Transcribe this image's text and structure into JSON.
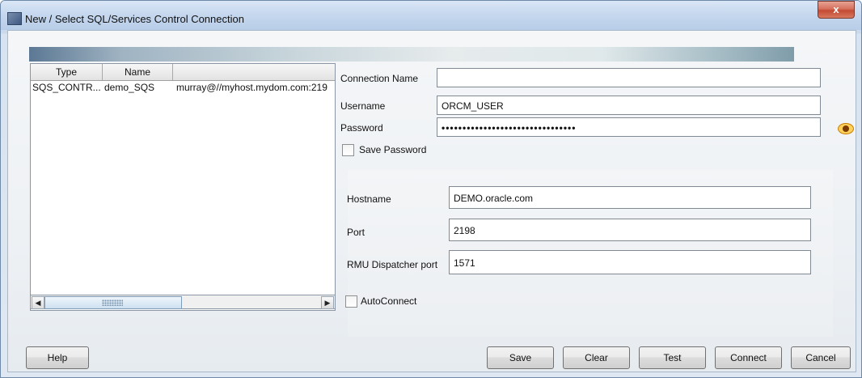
{
  "window": {
    "title": "New / Select SQL/Services Control Connection",
    "close_glyph": "x"
  },
  "list": {
    "columns": [
      "Type",
      "Name",
      ""
    ],
    "rows": [
      {
        "type": "SQS_CONTR...",
        "name": "demo_SQS",
        "connection": "murray@//myhost.mydom.com:219"
      }
    ]
  },
  "form": {
    "connection_name": {
      "label": "Connection Name",
      "value": ""
    },
    "username": {
      "label": "Username",
      "value": "ORCM_USER"
    },
    "password": {
      "label": "Password",
      "value": "••••••••••••••••••••••••••••••••"
    },
    "save_password": {
      "label": "Save Password",
      "checked": false
    },
    "hostname": {
      "label": "Hostname",
      "value": "DEMO.oracle.com"
    },
    "port": {
      "label": "Port",
      "value": "2198"
    },
    "rmu_port": {
      "label": "RMU Dispatcher port",
      "value": "1571"
    },
    "autoconnect": {
      "label": "AutoConnect",
      "checked": false
    }
  },
  "buttons": {
    "help": "Help",
    "save": "Save",
    "clear": "Clear",
    "test": "Test",
    "connect": "Connect",
    "cancel": "Cancel"
  },
  "icons": {
    "window": "app-window-icon",
    "show_password": "eye-icon"
  }
}
